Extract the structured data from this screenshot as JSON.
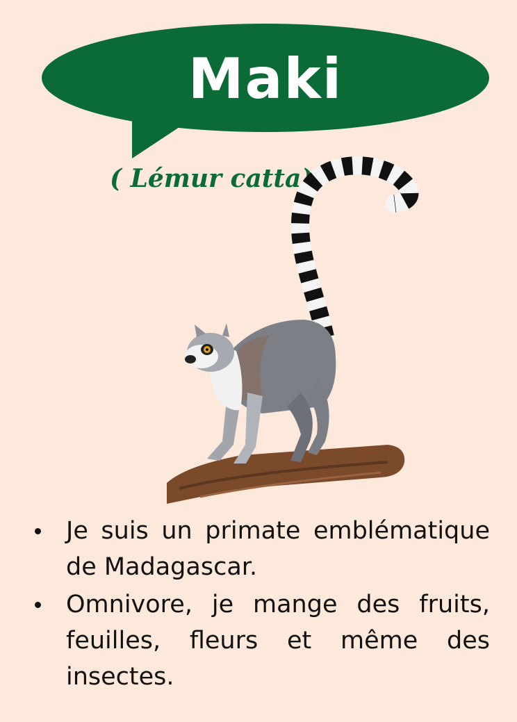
{
  "card": {
    "title": "Maki",
    "scientific_name": "( Lémur catta)",
    "facts": [
      "Je suis un primate emblématique de Madagascar.",
      "Omnivore, je mange des fruits, feuilles, fleurs et même des insectes."
    ],
    "colors": {
      "background": "#fde9dc",
      "bubble": "#0a6b37",
      "title_text": "#ffffff",
      "scientific_name_text": "#0a6b37",
      "body_text": "#111111"
    },
    "illustration": "ring-tailed-lemur-on-branch"
  }
}
